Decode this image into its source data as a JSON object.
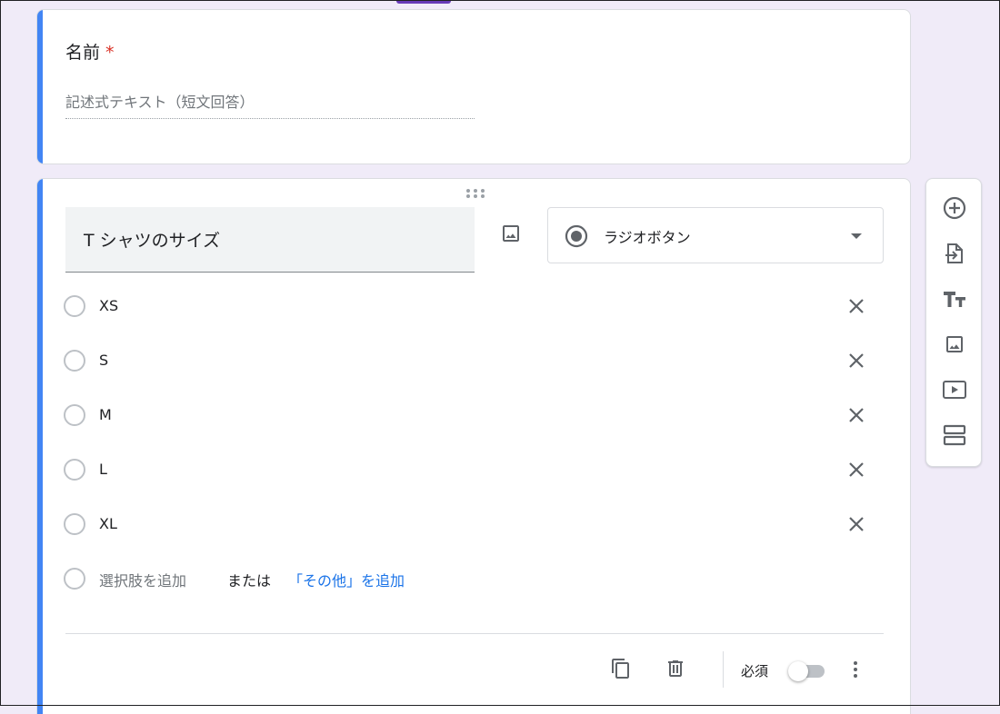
{
  "question1": {
    "title": "名前",
    "required_mark": "*",
    "answer_placeholder": "記述式テキスト（短文回答）"
  },
  "question2": {
    "title": "T シャツのサイズ",
    "type_label": "ラジオボタン",
    "options": [
      {
        "label": "XS"
      },
      {
        "label": "S"
      },
      {
        "label": "M"
      },
      {
        "label": "L"
      },
      {
        "label": "XL"
      }
    ],
    "add_option": "選択肢を追加",
    "or_text": "または",
    "add_other": "「その他」を追加",
    "required_label": "必須",
    "required_on": false
  },
  "icons": {
    "add_image": "image-icon",
    "remove": "close-icon",
    "duplicate": "copy-icon",
    "delete": "trash-icon",
    "more": "more-vert-icon"
  },
  "side_toolbar": [
    {
      "icon": "add-circle-icon"
    },
    {
      "icon": "import-icon"
    },
    {
      "icon": "title-icon"
    },
    {
      "icon": "image-icon"
    },
    {
      "icon": "video-icon"
    },
    {
      "icon": "section-icon"
    }
  ],
  "colors": {
    "accent_bar": "#4285f4",
    "theme": "#673ab7",
    "background": "#f0ebf8",
    "link": "#1a73e8",
    "required": "#d93025"
  }
}
